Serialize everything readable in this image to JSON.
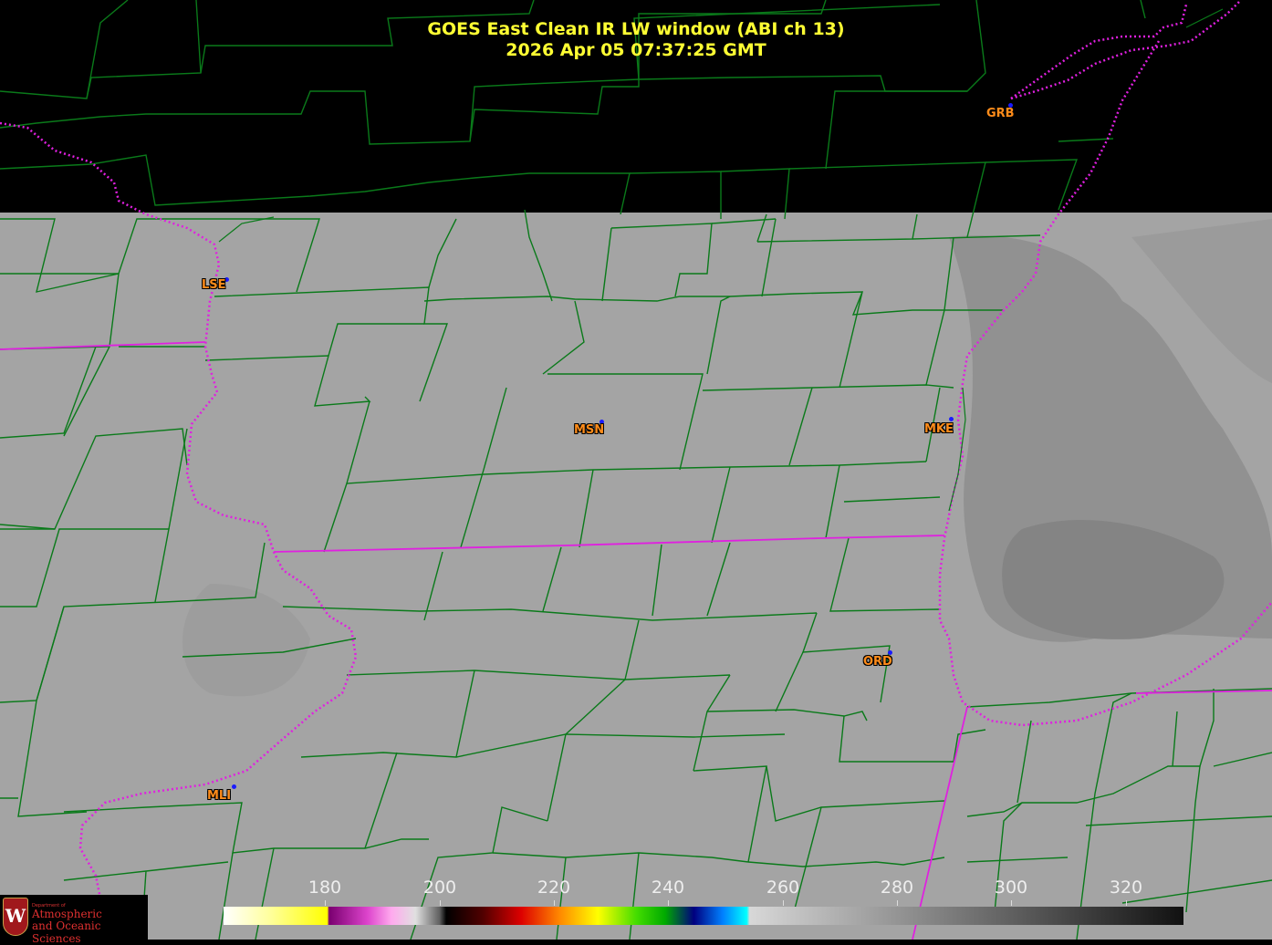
{
  "title": {
    "line1": "GOES East Clean IR LW window (ABI ch 13)",
    "line2": "2026 Apr 05  07:37:25 GMT"
  },
  "colors": {
    "title": "#ffff33",
    "county_lines": "#0a7a1a",
    "state_lines": "#e020e0",
    "city_labels": "#ff8c1a",
    "station_dots": "#1a1aff",
    "cloud_gray": "#a4a4a4",
    "no_data": "#000000"
  },
  "cities": [
    {
      "code": "GRB"
    },
    {
      "code": "LSE"
    },
    {
      "code": "MSN"
    },
    {
      "code": "MKE"
    },
    {
      "code": "ORD"
    },
    {
      "code": "MLI"
    }
  ],
  "colorbar": {
    "ticks": [
      "180",
      "200",
      "220",
      "240",
      "260",
      "280",
      "300",
      "320"
    ]
  },
  "logo": {
    "dept": "Department of",
    "line1": "Atmospheric",
    "line2": "and Oceanic Sciences",
    "shield_letter": "W"
  }
}
